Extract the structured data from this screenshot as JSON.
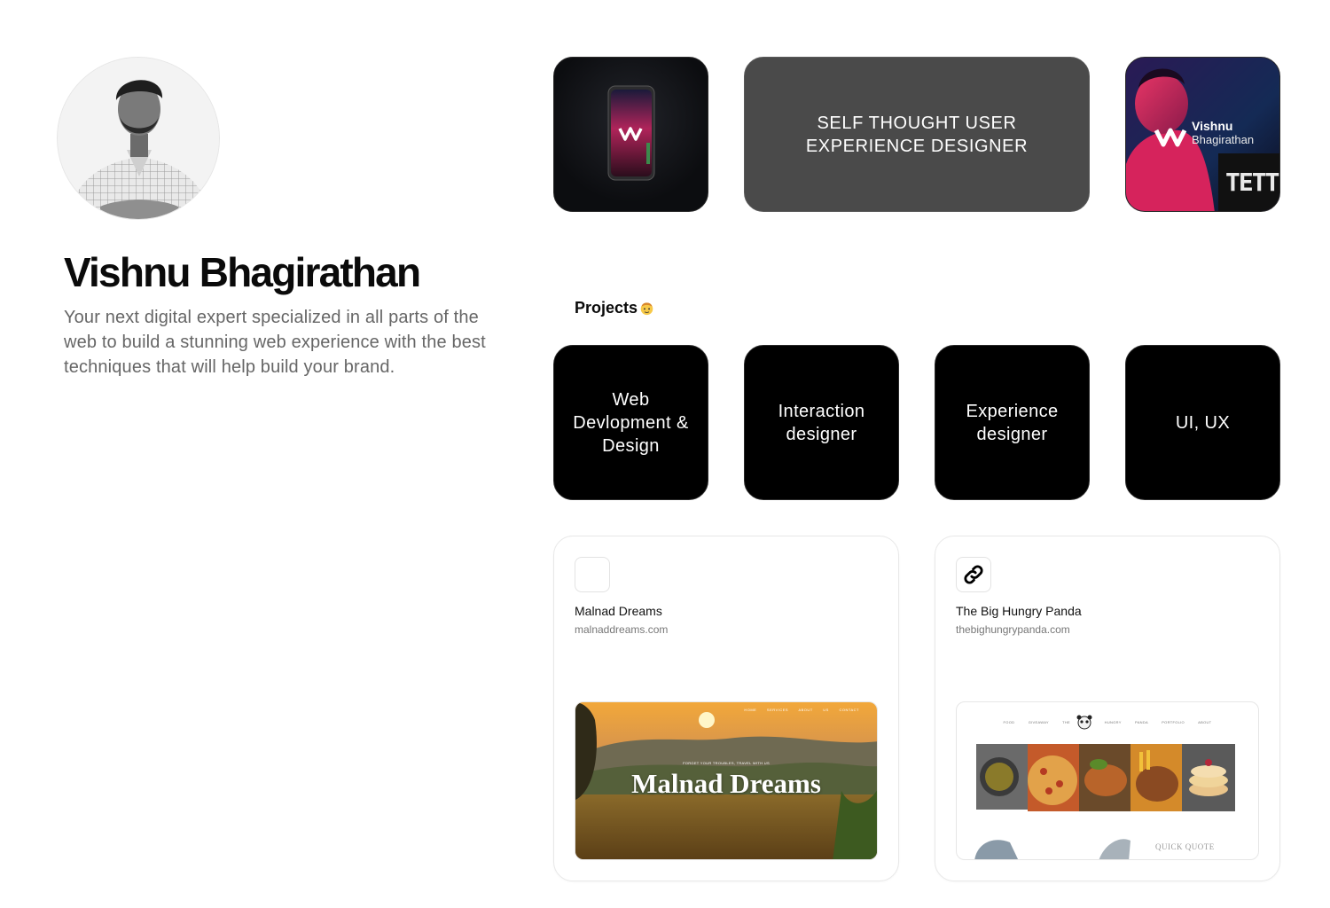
{
  "profile": {
    "name": "Vishnu Bhagirathan",
    "bio": "Your next digital expert specialized in all parts of the web to build a stunning web experience with the best techniques that will help build your brand."
  },
  "hero": {
    "tagline": "SELF THOUGHT USER EXPERIENCE DESIGNER",
    "photo_caption_first": "Vishnu",
    "photo_caption_last": "Bhagirathan",
    "photo_sign": "TETT"
  },
  "projects": {
    "title": "Projects",
    "skills": [
      {
        "label": "Web Devlopment & Design"
      },
      {
        "label": "Interaction designer"
      },
      {
        "label": "Experience designer"
      },
      {
        "label": "UI, UX"
      }
    ],
    "links": [
      {
        "title": "Malnad Dreams",
        "url": "malnaddreams.com",
        "preview_heading": "Malnad Dreams",
        "preview_subheading": "FORGET YOUR TROUBLES, TRAVEL WITH US",
        "preview_nav": "HOME SERVICES ABOUT US CONTACT"
      },
      {
        "title": "The Big Hungry Panda",
        "url": "thebighungrypanda.com",
        "preview_nav": "FOOD GIVEAWAY THE BIG HUNGRY PANDA PORTFOLIO ABOUT",
        "preview_quote": "QUICK QUOTE"
      }
    ]
  },
  "icons": {
    "favicon_1": "blank-favicon-icon",
    "favicon_2": "link-icon",
    "emoji": "face-emoji-icon"
  },
  "colors": {
    "tagline_bg": "#4a4a4a",
    "skill_bg": "#000000",
    "muted_text": "#666666"
  }
}
